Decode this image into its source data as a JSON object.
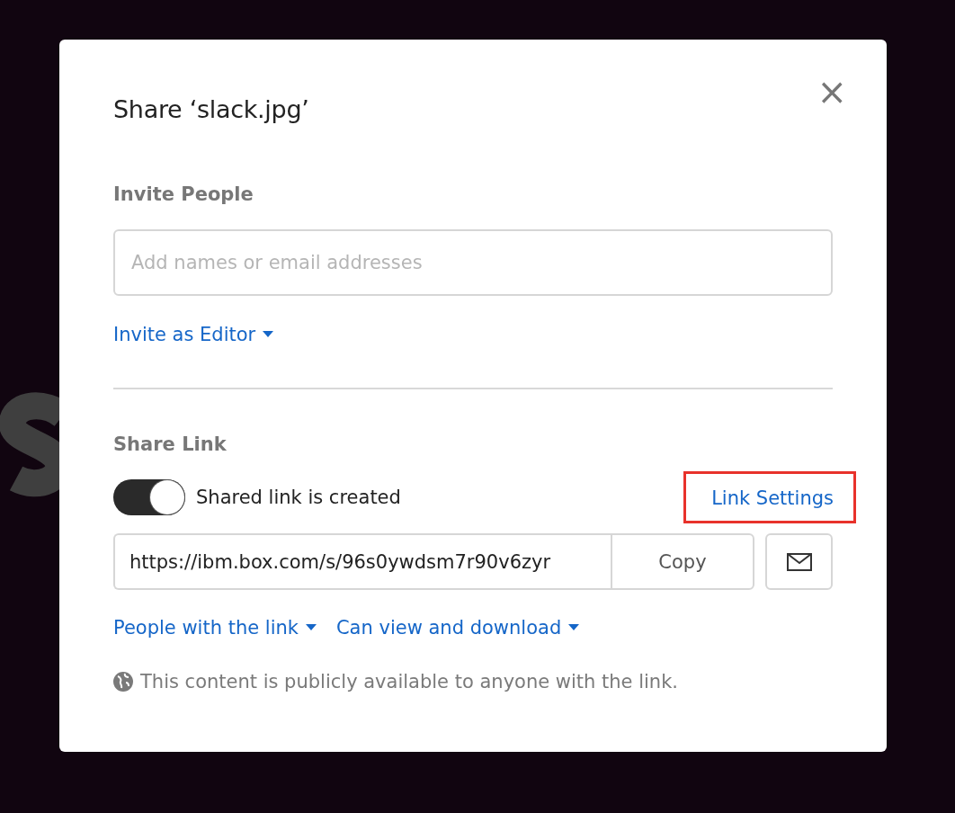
{
  "dialog": {
    "title": "Share ‘slack.jpg’",
    "close": "×"
  },
  "invite": {
    "heading": "Invite People",
    "placeholder": "Add names or email addresses",
    "role_link": "Invite as Editor"
  },
  "share_link": {
    "heading": "Share Link",
    "toggle": {
      "label": "Shared link is created",
      "on": true
    },
    "settings_link": {
      "label": "Link Settings",
      "highlighted": true
    },
    "url": "https://ibm.box.com/s/96s0ywdsm7r90v6zyr",
    "copy_button": "Copy",
    "dropdowns": [
      "People with the link",
      "Can view and download"
    ],
    "notice": "This content is publicly available to anyone with the link."
  }
}
